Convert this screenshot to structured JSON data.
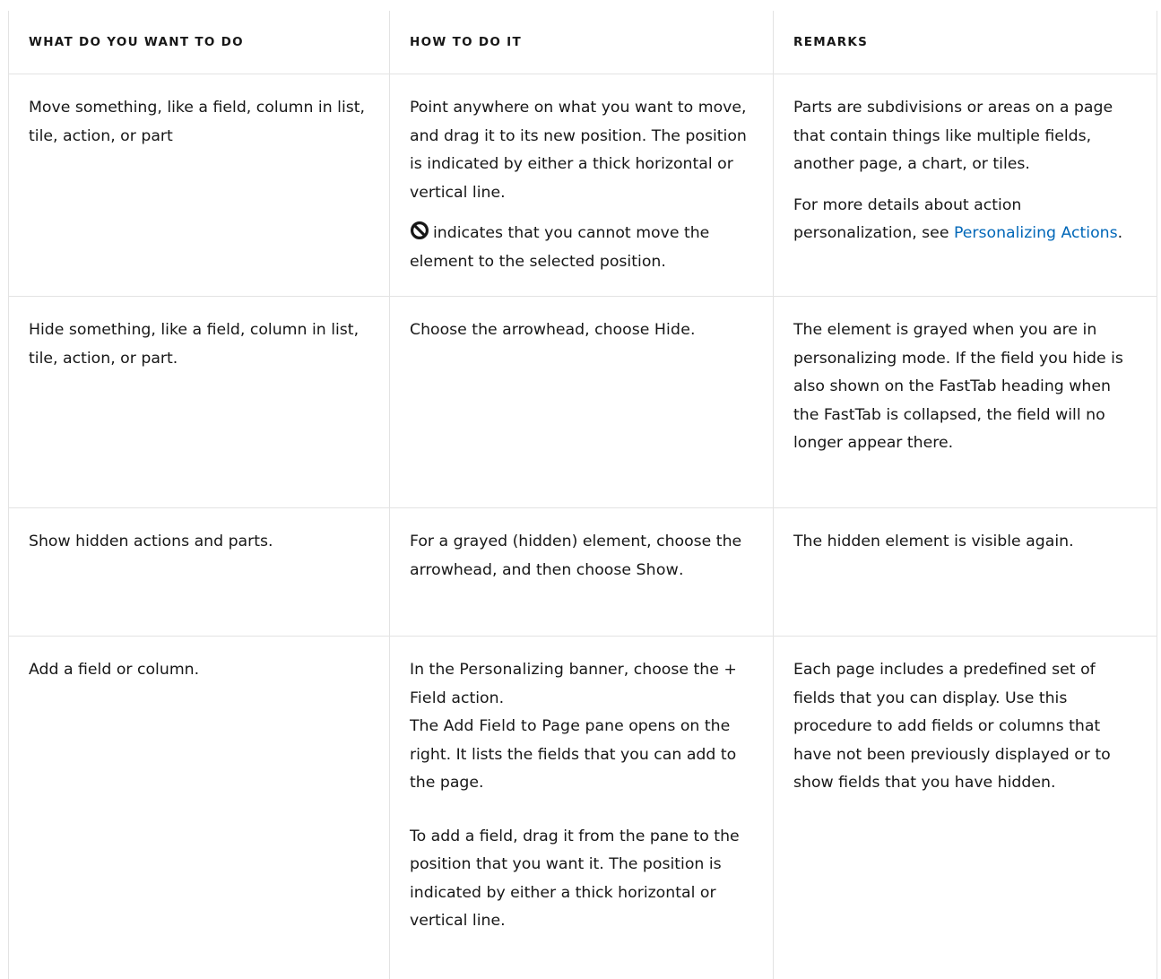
{
  "table": {
    "headers": [
      "WHAT DO YOU WANT TO DO",
      "HOW TO DO IT",
      "REMARKS"
    ],
    "rows": [
      {
        "what": "Move something, like a field, column in list, tile, action, or part",
        "how_p1": "Point anywhere on what you want to move, and drag it to its new position. The position is indicated by either a thick horizontal or vertical line.",
        "how_p2_icon": "no-entry-icon",
        "how_p2": "indicates that you cannot move the element to the selected position.",
        "remarks_p1": "Parts are subdivisions or areas on a page that contain things like multiple fields, another page, a chart, or tiles.",
        "remarks_p2_pre": "For more details about action personalization, see ",
        "remarks_p2_link": "Personalizing Actions",
        "remarks_p2_post": "."
      },
      {
        "what": "Hide something, like a field, column in list, tile, action, or part.",
        "how_pre": "Choose the arrowhead, choose ",
        "how_ui": "Hide",
        "how_post": ".",
        "remarks": "The element is grayed when you are in personalizing mode. If the field you hide is also shown on the FastTab heading when the FastTab is collapsed, the field will no longer appear there."
      },
      {
        "what": "Show hidden actions and parts.",
        "how_pre": "For a grayed (hidden) element, choose the arrowhead, and then choose ",
        "how_ui": "Show",
        "how_post": ".",
        "remarks": "The hidden element is visible again."
      },
      {
        "what": "Add a field or column.",
        "how_l1_pre": "In the ",
        "how_l1_ui": "Personalizing",
        "how_l1_mid": " banner, choose the ",
        "how_l1_ui2": "+ Field",
        "how_l1_post": " action.",
        "how_l2_pre": "The ",
        "how_l2_ui": "Add Field to Page",
        "how_l2_post": " pane opens on the right. It lists the fields that you can add to the page.",
        "how_p2": "To add a field, drag it from the pane to the position that you want it. The position is indicated by either a thick horizontal or vertical line.",
        "remarks": "Each page includes a predefined set of fields that you can display. Use this procedure to add fields or columns that have not been previously displayed or to show fields that you have hidden."
      }
    ]
  },
  "colors": {
    "text": "#171717",
    "border": "#e3e3e3",
    "link": "#0067b8"
  }
}
